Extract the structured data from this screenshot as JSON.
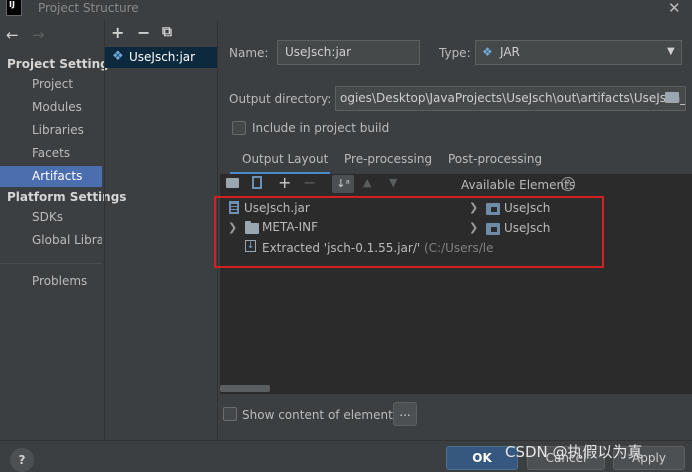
{
  "window": {
    "title": "Project Structure",
    "logo_text": "IJ",
    "close_glyph": "✕"
  },
  "nav": {
    "back_glyph": "←",
    "forward_glyph": "→",
    "sections": [
      {
        "title": "Project Settings",
        "items": [
          "Project",
          "Modules",
          "Libraries",
          "Facets",
          "Artifacts"
        ]
      },
      {
        "title": "Platform Settings",
        "items": [
          "SDKs",
          "Global Libraries"
        ]
      }
    ],
    "problems": "Problems",
    "selected": "Artifacts"
  },
  "artifacts_toolbar": {
    "add": "+",
    "remove": "−",
    "copy": "⧉"
  },
  "artifact_list": [
    {
      "label": "UseJsch:jar",
      "icon": "artifact-icon"
    }
  ],
  "form": {
    "name_label": "Name:",
    "name_value": "UseJsch:jar",
    "type_label": "Type:",
    "type_value": "JAR",
    "type_arrow": "▼",
    "output_dir_label": "Output directory:",
    "output_dir_value": "ogies\\Desktop\\JavaProjects\\UseJsch\\out\\artifacts\\UseJsch_jar",
    "include_in_build_label": "Include in project build",
    "include_in_build_checked": false
  },
  "tabs": [
    "Output Layout",
    "Pre-processing",
    "Post-processing"
  ],
  "active_tab": "Output Layout",
  "layout_toolbar": {
    "available_elements_label": "Available Elements",
    "icons": [
      "new-folder-icon",
      "archive-icon",
      "add-icon",
      "remove-icon",
      "sort-icon",
      "move-up-icon",
      "move-down-icon",
      "help-icon"
    ]
  },
  "output_tree": [
    {
      "label": "UseJsch.jar",
      "icon": "jar-icon",
      "expandable": false
    },
    {
      "label": "META-INF",
      "icon": "folder-icon",
      "expandable": true
    },
    {
      "label": "Extracted 'jsch-0.1.55.jar/'",
      "suffix": "(C:/Users/le",
      "icon": "extracted-icon",
      "expandable": false
    }
  ],
  "available_tree": [
    {
      "label": "UseJsch",
      "icon": "module-icon",
      "expandable": true
    },
    {
      "label": "UseJsch",
      "icon": "module-icon",
      "expandable": true
    }
  ],
  "show_content_label": "Show content of elements",
  "ellipsis_button": "...",
  "buttons": {
    "help": "?",
    "ok": "OK",
    "cancel": "Cancel",
    "apply": "Apply"
  },
  "watermark": "CSDN @执假以为真",
  "colors": {
    "selection": "#4b6eaf",
    "highlight": "#d32020",
    "ok_button": "#365880",
    "tab_underline": "#4a88c7"
  }
}
